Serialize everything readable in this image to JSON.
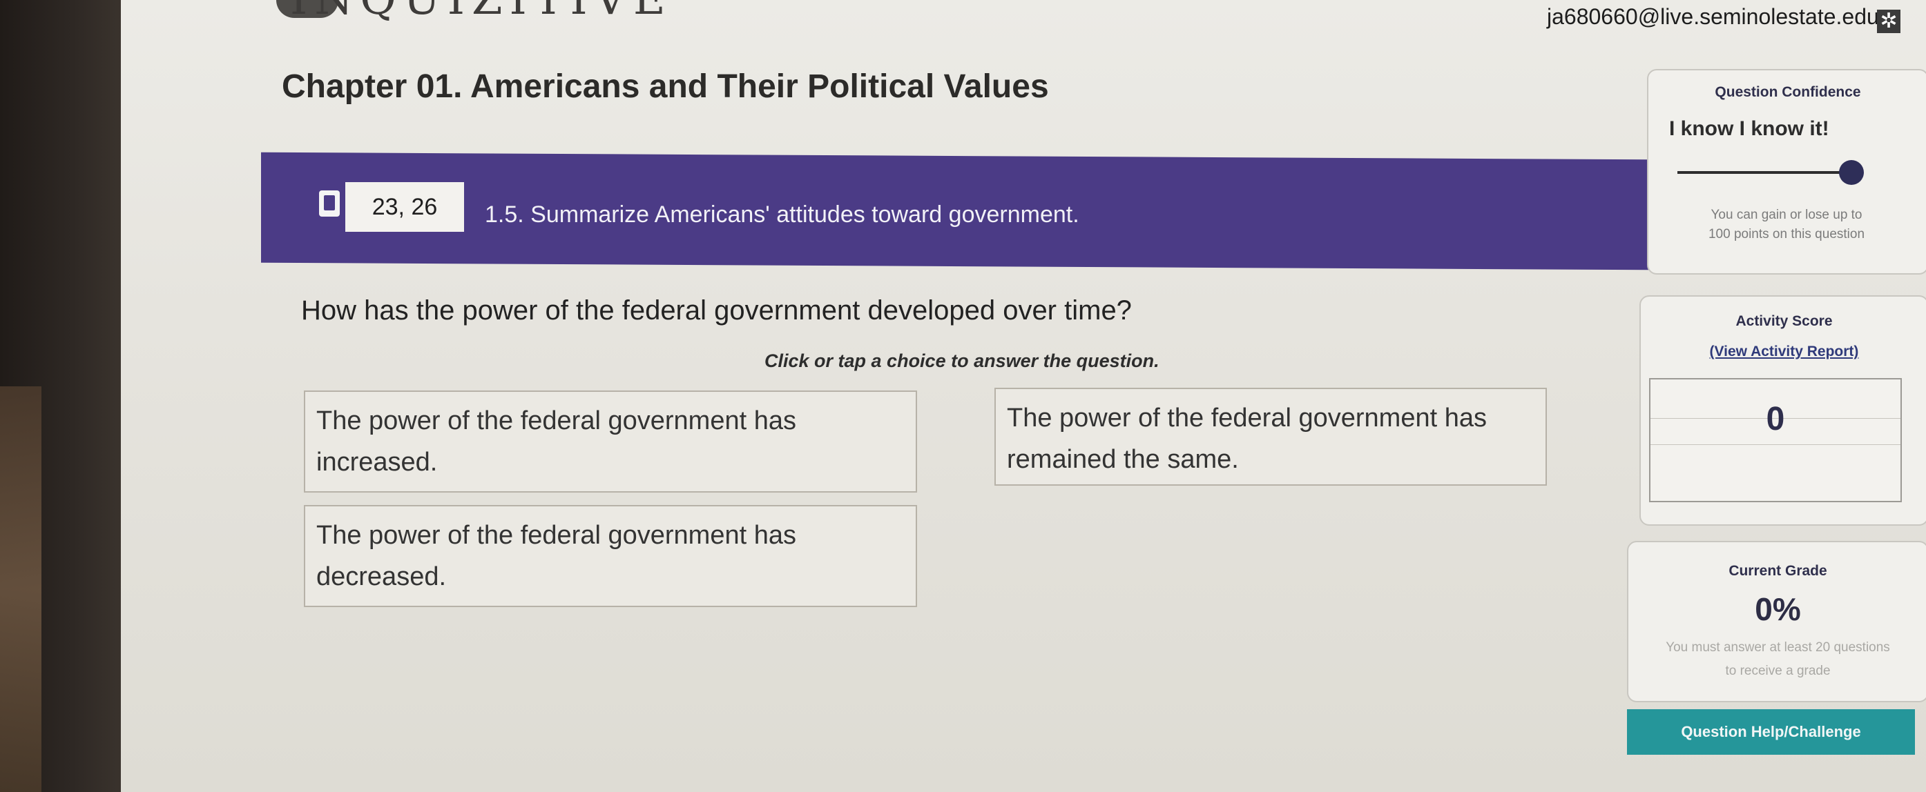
{
  "header": {
    "brand": "INQUIZITIVE",
    "user_email": "ja680660@live.seminolestate.edu",
    "settings_icon": "gear-icon"
  },
  "chapter": {
    "title": "Chapter 01. Americans and Their Political Values"
  },
  "objective": {
    "book_icon": "book-icon",
    "pages": "23, 26",
    "text": "1.5. Summarize Americans' attitudes toward government."
  },
  "question": {
    "prompt": "How has the power of the federal government developed over time?",
    "instruction": "Click or tap a choice to answer the question.",
    "choices": [
      "The power of the federal government has increased.",
      "The power of the federal government has remained the same.",
      "The power of the federal government has decreased."
    ]
  },
  "confidence": {
    "title": "Question Confidence",
    "level": "I know I know it!",
    "slider_value_percent": 100,
    "note_line1": "You can gain or lose up to",
    "note_line2": "100 points on this question"
  },
  "activity": {
    "title": "Activity Score",
    "report_link": "(View Activity Report)",
    "score": "0"
  },
  "grade": {
    "title": "Current Grade",
    "value": "0%",
    "note_line1": "You must answer at least 20 questions",
    "note_line2": "to receive a grade"
  },
  "help": {
    "label": "Question Help/Challenge"
  },
  "colors": {
    "objective_bar": "#4b3b86",
    "help_button": "#25969a"
  }
}
